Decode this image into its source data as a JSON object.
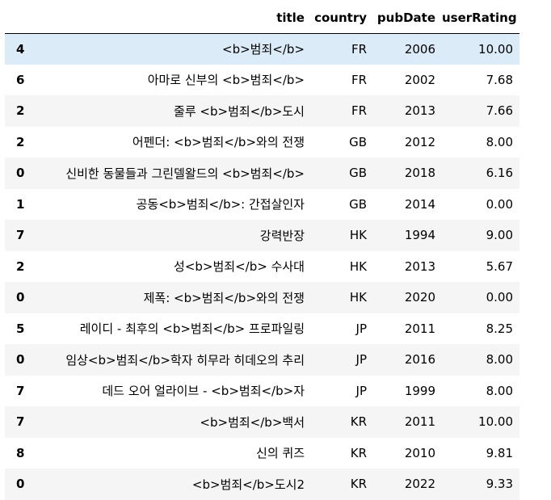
{
  "table": {
    "index_header": "",
    "columns": [
      "title",
      "country",
      "pubDate",
      "userRating"
    ],
    "rows": [
      {
        "index": "4",
        "title": "<b>범죄</b>",
        "country": "FR",
        "pubDate": "2006",
        "userRating": "10.00"
      },
      {
        "index": "6",
        "title": "아마로 신부의 <b>범죄</b>",
        "country": "FR",
        "pubDate": "2002",
        "userRating": "7.68"
      },
      {
        "index": "2",
        "title": "줄루 <b>범죄</b>도시",
        "country": "FR",
        "pubDate": "2013",
        "userRating": "7.66"
      },
      {
        "index": "2",
        "title": "어펜더: <b>범죄</b>와의 전쟁",
        "country": "GB",
        "pubDate": "2012",
        "userRating": "8.00"
      },
      {
        "index": "0",
        "title": "신비한 동물들과 그린델왈드의 <b>범죄</b>",
        "country": "GB",
        "pubDate": "2018",
        "userRating": "6.16"
      },
      {
        "index": "1",
        "title": "공동<b>범죄</b>: 간접살인자",
        "country": "GB",
        "pubDate": "2014",
        "userRating": "0.00"
      },
      {
        "index": "7",
        "title": "강력반장",
        "country": "HK",
        "pubDate": "1994",
        "userRating": "9.00"
      },
      {
        "index": "2",
        "title": "성<b>범죄</b> 수사대",
        "country": "HK",
        "pubDate": "2013",
        "userRating": "5.67"
      },
      {
        "index": "0",
        "title": "제폭: <b>범죄</b>와의 전쟁",
        "country": "HK",
        "pubDate": "2020",
        "userRating": "0.00"
      },
      {
        "index": "5",
        "title": "레이디 - 최후의 <b>범죄</b> 프로파일링",
        "country": "JP",
        "pubDate": "2011",
        "userRating": "8.25"
      },
      {
        "index": "0",
        "title": "임상<b>범죄</b>학자 히무라 히데오의 추리",
        "country": "JP",
        "pubDate": "2016",
        "userRating": "8.00"
      },
      {
        "index": "7",
        "title": "데드 오어 얼라이브 - <b>범죄</b>자",
        "country": "JP",
        "pubDate": "1999",
        "userRating": "8.00"
      },
      {
        "index": "7",
        "title": "<b>범죄</b>백서",
        "country": "KR",
        "pubDate": "2011",
        "userRating": "10.00"
      },
      {
        "index": "8",
        "title": "신의 퀴즈",
        "country": "KR",
        "pubDate": "2010",
        "userRating": "9.81"
      },
      {
        "index": "0",
        "title": "<b>범죄</b>도시2",
        "country": "KR",
        "pubDate": "2022",
        "userRating": "9.33"
      }
    ]
  },
  "colors": {
    "stripe": "#f5f5f5",
    "hover": "#dcebf8",
    "header_rule": "#000000"
  }
}
